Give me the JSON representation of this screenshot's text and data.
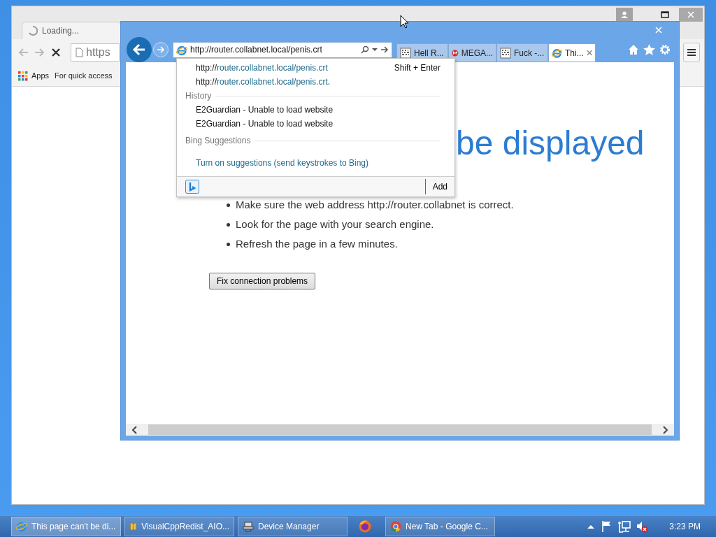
{
  "chrome_window": {
    "tab": {
      "title": "Loading..."
    },
    "address": "https",
    "bookmarks": [
      {
        "kind": "apps",
        "label": "Apps"
      },
      {
        "kind": "text",
        "label": "For quick access"
      }
    ]
  },
  "ie_window": {
    "address": "http://router.collabnet.local/penis.crt",
    "tabs": [
      {
        "kind": "file",
        "title": "Hell R...",
        "selected": false
      },
      {
        "kind": "mega",
        "title": "MEGA...",
        "selected": false
      },
      {
        "kind": "file",
        "title": "Fuck -...",
        "selected": false
      },
      {
        "kind": "ie",
        "title": "Thi...",
        "selected": true
      }
    ],
    "dropdown": {
      "url_items": [
        {
          "prefix": "http://",
          "link": "router.collabnet.local/penis.crt",
          "hint": "Shift + Enter"
        },
        {
          "prefix": "http://",
          "link": "router.collabnet.local/penis.crt",
          "suffix": "."
        }
      ],
      "sections": [
        {
          "heading": "History",
          "items": [
            {
              "kind": "plain",
              "text": "E2Guardian - Unable to load website"
            },
            {
              "kind": "plain",
              "text": "E2Guardian - Unable to load website"
            }
          ]
        },
        {
          "heading": "Bing Suggestions",
          "items": [
            {
              "kind": "link",
              "text": "Turn on suggestions (send keystrokes to Bing)"
            }
          ]
        }
      ],
      "add_label": "Add"
    },
    "page": {
      "heading": "be displayed",
      "bullets": [
        "Make sure the web address http://router.collabnet is correct.",
        "Look for the page with your search engine.",
        "Refresh the page in a few minutes."
      ],
      "button": "Fix connection problems"
    }
  },
  "taskbar": {
    "items": [
      {
        "kind": "ie",
        "label": "This page can't be di...",
        "selected": true
      },
      {
        "kind": "archive",
        "label": "VisualCppRedist_AIO...",
        "selected": false
      },
      {
        "kind": "device",
        "label": "Device Manager",
        "selected": false
      },
      {
        "kind": "firefox",
        "selected": false
      },
      {
        "kind": "chrome",
        "label": "New Tab - Google C...",
        "selected": false
      }
    ],
    "clock": "3:23 PM"
  }
}
